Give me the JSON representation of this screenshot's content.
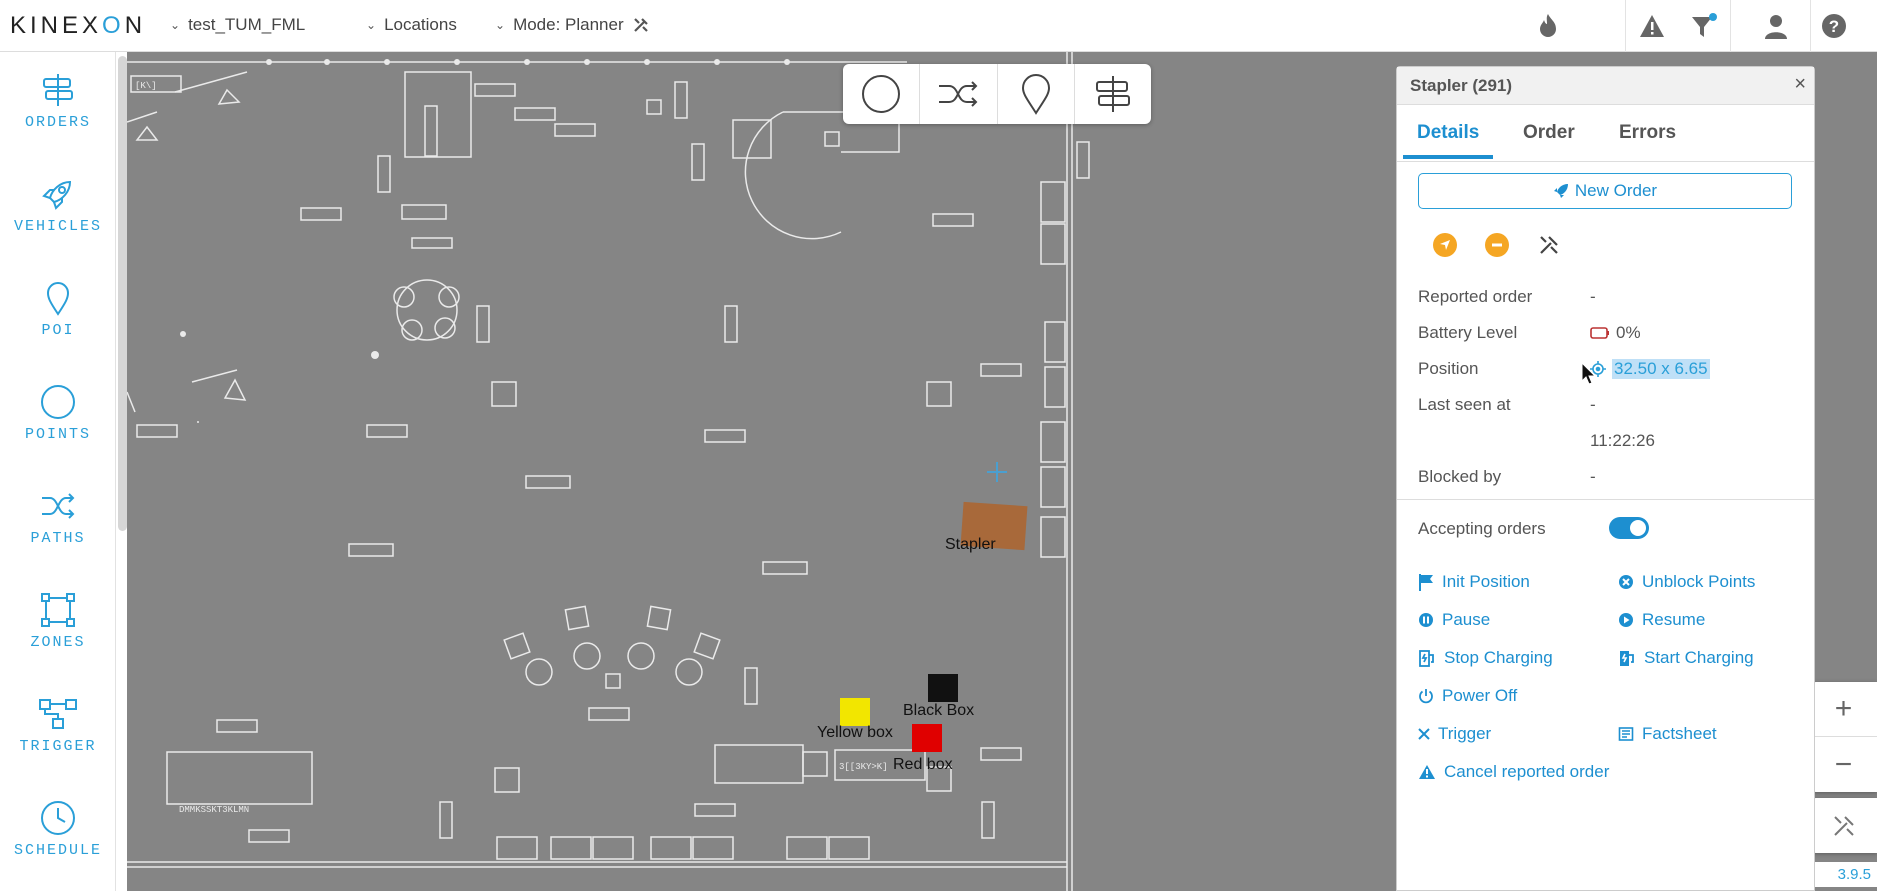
{
  "app": {
    "logo": "KINEXON"
  },
  "topbar": {
    "project": "test_TUM_FML",
    "locations": "Locations",
    "mode": "Mode: Planner",
    "icons": [
      "flame-icon",
      "warning-icon",
      "filter-icon",
      "user-icon",
      "help-icon"
    ]
  },
  "sidebar": {
    "items": [
      {
        "label": "ORDERS",
        "icon": "signpost-icon"
      },
      {
        "label": "VEHICLES",
        "icon": "rocket-icon"
      },
      {
        "label": "POI",
        "icon": "map-pin-icon"
      },
      {
        "label": "POINTS",
        "icon": "circle-icon"
      },
      {
        "label": "PATHS",
        "icon": "shuffle-icon"
      },
      {
        "label": "ZONES",
        "icon": "zone-square-icon"
      },
      {
        "label": "TRIGGER",
        "icon": "trigger-flow-icon"
      },
      {
        "label": "SCHEDULE",
        "icon": "clock-icon"
      }
    ]
  },
  "map": {
    "tools": [
      "circle-tool-icon",
      "shuffle-tool-icon",
      "pin-tool-icon",
      "signpost-tool-icon"
    ],
    "objects": {
      "stapler": "Stapler",
      "black_box": "Black Box",
      "yellow_box": "Yellow box",
      "red_box": "Red box"
    },
    "zoom_in": "+",
    "zoom_out": "−",
    "version": "3.9.5"
  },
  "panel": {
    "title": "Stapler (291)",
    "close": "×",
    "tabs": [
      "Details",
      "Order",
      "Errors"
    ],
    "new_order": "New Order",
    "fields": {
      "reported_order_label": "Reported order",
      "reported_order_value": "-",
      "battery_label": "Battery Level",
      "battery_value": "0%",
      "position_label": "Position",
      "position_value": "32.50 x 6.65",
      "last_seen_label": "Last seen at",
      "last_seen_value": "-",
      "last_seen_time": "11:22:26",
      "blocked_by_label": "Blocked by",
      "blocked_by_value": "-"
    },
    "accepting_orders_label": "Accepting orders",
    "accepting_orders": true,
    "actions": {
      "init_position": "Init Position",
      "unblock_points": "Unblock Points",
      "pause": "Pause",
      "resume": "Resume",
      "stop_charging": "Stop Charging",
      "start_charging": "Start Charging",
      "power_off": "Power Off",
      "trigger": "Trigger",
      "factsheet": "Factsheet",
      "cancel_reported_order": "Cancel reported order"
    },
    "colors": {
      "accent": "#1d8fd0",
      "orange": "#f5a623",
      "map_bg": "#858585"
    }
  }
}
